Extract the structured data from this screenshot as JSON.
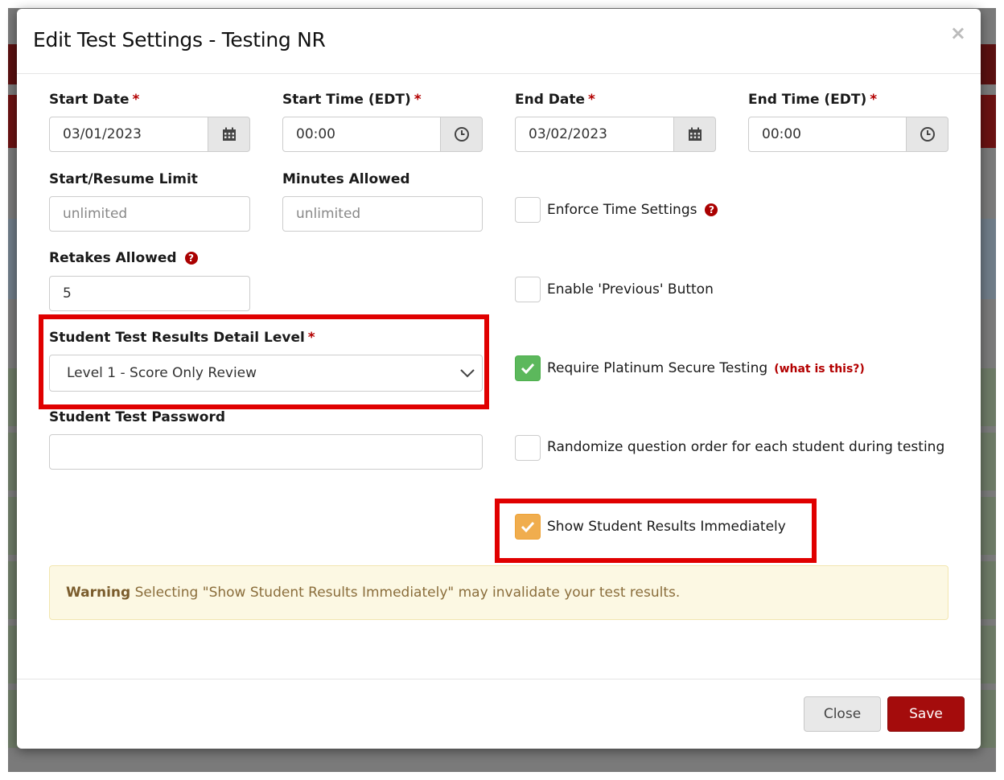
{
  "modal": {
    "title": "Edit Test Settings - Testing NR",
    "close_symbol": "×"
  },
  "fields": {
    "start_date": {
      "label": "Start Date",
      "value": "03/01/2023",
      "icon": "calendar-icon"
    },
    "start_time": {
      "label": "Start Time (EDT)",
      "value": "00:00",
      "icon": "clock-icon"
    },
    "end_date": {
      "label": "End Date",
      "value": "03/02/2023",
      "icon": "calendar-icon"
    },
    "end_time": {
      "label": "End Time (EDT)",
      "value": "00:00",
      "icon": "clock-icon"
    },
    "start_resume_limit": {
      "label": "Start/Resume Limit",
      "placeholder": "unlimited"
    },
    "minutes_allowed": {
      "label": "Minutes Allowed",
      "placeholder": "unlimited"
    },
    "retakes_allowed": {
      "label": "Retakes Allowed",
      "value": "5"
    },
    "detail_level": {
      "label": "Student Test Results Detail Level",
      "selected": "Level 1 - Score Only Review"
    },
    "password": {
      "label": "Student Test Password",
      "value": ""
    },
    "required_marker": "*",
    "help_symbol": "?"
  },
  "checkboxes": {
    "enforce_time": {
      "label": "Enforce Time Settings",
      "checked": false
    },
    "enable_previous": {
      "label": "Enable 'Previous' Button",
      "checked": false
    },
    "platinum_secure": {
      "label": "Require Platinum Secure Testing",
      "link": "(what is this?)",
      "checked": true,
      "color": "#5cb85c"
    },
    "randomize": {
      "label": "Randomize question order for each student during testing",
      "checked": false
    },
    "show_results": {
      "label": "Show Student Results Immediately",
      "checked": true,
      "color": "#f0ad4e"
    }
  },
  "alert": {
    "strong": "Warning",
    "text": " Selecting \"Show Student Results Immediately\" may invalidate your test results."
  },
  "footer": {
    "close_label": "Close",
    "save_label": "Save"
  },
  "colors": {
    "accent": "#a40c0c",
    "highlight": "#e00000"
  }
}
